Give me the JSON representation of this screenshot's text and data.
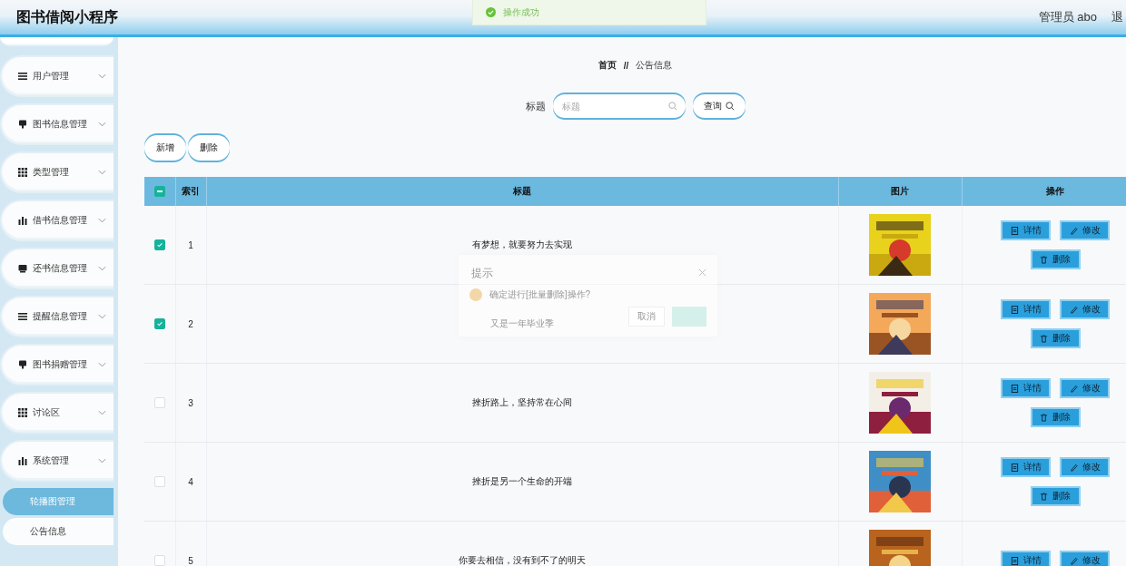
{
  "header": {
    "title": "图书借阅小程序",
    "user": "管理员 abo",
    "logout": "退"
  },
  "toast": {
    "message": "操作成功"
  },
  "sidebar": {
    "items": [
      {
        "label": "用户管理"
      },
      {
        "label": "图书信息管理"
      },
      {
        "label": "类型管理"
      },
      {
        "label": "借书信息管理"
      },
      {
        "label": "还书信息管理"
      },
      {
        "label": "提醒信息管理"
      },
      {
        "label": "图书捐赠管理"
      },
      {
        "label": "讨论区"
      },
      {
        "label": "系统管理",
        "children": [
          {
            "label": "轮播图管理",
            "selected": true
          },
          {
            "label": "公告信息",
            "selected": false
          }
        ]
      }
    ]
  },
  "breadcrumb": {
    "home": "首页",
    "separator": "//",
    "current": "公告信息"
  },
  "search": {
    "label": "标题",
    "placeholder": "标题",
    "button": "查询"
  },
  "toolbar": [
    "新增",
    "删除"
  ],
  "table": {
    "columns": [
      "索引",
      "标题",
      "图片",
      "操作"
    ],
    "select_all": {
      "indeterminate": true
    },
    "rows": [
      {
        "index": "1",
        "title": "有梦想，就要努力去实现",
        "checked": true,
        "actions": [
          "详情",
          "修改",
          "删除"
        ]
      },
      {
        "index": "2",
        "title": "又是一年毕业季",
        "checked": true,
        "actions": [
          "详情",
          "修改",
          "删除"
        ]
      },
      {
        "index": "3",
        "title": "挫折路上，坚持常在心间",
        "checked": false,
        "actions": [
          "详情",
          "修改",
          "删除"
        ]
      },
      {
        "index": "4",
        "title": "挫折是另一个生命的开端",
        "checked": false,
        "actions": [
          "详情",
          "修改",
          "删除"
        ]
      },
      {
        "index": "5",
        "title": "你要去相信，没有到不了的明天",
        "checked": false,
        "actions": [
          "详情",
          "修改"
        ]
      }
    ]
  },
  "dialog": {
    "title": "提示",
    "message": "确定进行[批量删除]操作?",
    "cancel": "取消"
  }
}
